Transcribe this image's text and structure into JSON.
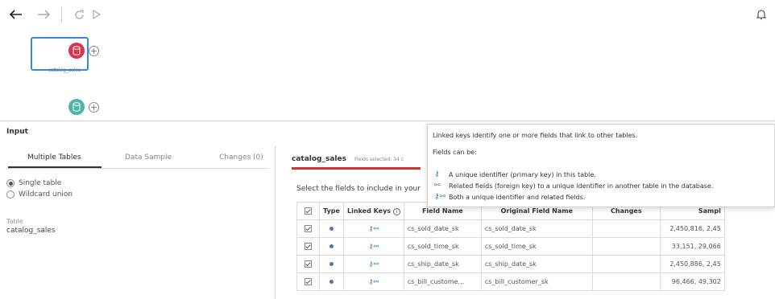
{
  "icons": {
    "back": "arrow-left",
    "forward": "arrow-right",
    "refresh": "refresh",
    "run": "play",
    "alerts": "bell",
    "input_node": "database",
    "output_node": "database",
    "add": "plus-circle",
    "info": "info-circle",
    "linked_key": "key-link",
    "primary_key": "key",
    "both_keys": "key-and-link"
  },
  "colors": {
    "accent": "#3b8bd8",
    "input_node": "#d8364f",
    "output_node": "#4fb3a8",
    "active_tab_accent": "#c33"
  },
  "flow": {
    "node_label": "catalog_sales"
  },
  "panel": {
    "title": "Input",
    "tabs": [
      {
        "label": "Multiple Tables",
        "active": true
      },
      {
        "label": "Data Sample",
        "active": false
      },
      {
        "label": "Changes (0)",
        "active": false
      }
    ],
    "options": [
      {
        "label": "Single table",
        "selected": true
      },
      {
        "label": "Wildcard union",
        "selected": false
      }
    ],
    "table_label": "Table",
    "table_value": "catalog_sales"
  },
  "fields_panel": {
    "table_name": "catalog_sales",
    "fields_selected": "Fields selected: 34 c",
    "hint": "Select the fields to include in your",
    "columns": [
      "Type",
      "Linked Keys",
      "Field Name",
      "Original Field Name",
      "Changes",
      "Sampl"
    ],
    "rows": [
      {
        "field": "cs_sold_date_sk",
        "original": "cs_sold_date_sk",
        "changes": "",
        "sample": "2,450,816, 2,45"
      },
      {
        "field": "cs_sold_time_sk",
        "original": "cs_sold_time_sk",
        "changes": "",
        "sample": "33,151, 29,066"
      },
      {
        "field": "cs_ship_date_sk",
        "original": "cs_ship_date_sk",
        "changes": "",
        "sample": "2,450,886, 2,45"
      },
      {
        "field": "cs_bill_custome...",
        "original": "cs_bill_customer_sk",
        "changes": "",
        "sample": "96,466, 49,302"
      }
    ]
  },
  "tooltip": {
    "line1": "Linked keys identify one or more fields that link to other tables.",
    "line2": "Fields can be:",
    "items": [
      "A unique identifier (primary key) in this table.",
      "Related fields (foreign key) to a unique identifier in another table in the database.",
      "Both a unique identifier and related fields."
    ]
  }
}
